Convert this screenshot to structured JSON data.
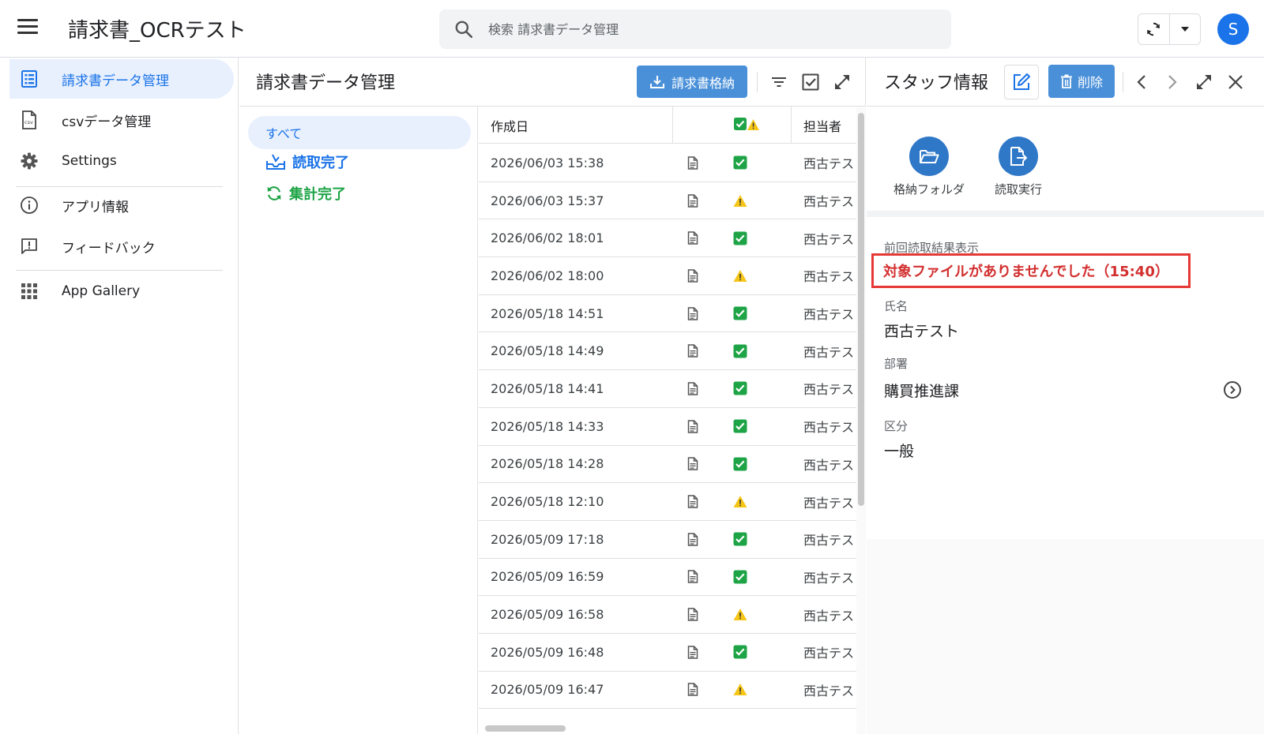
{
  "app": {
    "title": "請求書_OCRテスト",
    "avatar_letter": "S"
  },
  "search": {
    "placeholder": "検索 請求書データ管理"
  },
  "nav": {
    "items": [
      {
        "label": "請求書データ管理"
      },
      {
        "label": "csvデータ管理"
      },
      {
        "label": "Settings"
      },
      {
        "label": "アプリ情報"
      },
      {
        "label": "フィードバック"
      },
      {
        "label": "App Gallery"
      }
    ]
  },
  "middle": {
    "title": "請求書データ管理",
    "primary_button": "請求書格納",
    "filters": {
      "all": "すべて",
      "read_done": "読取完了",
      "aggregate_done": "集計完了"
    },
    "table": {
      "col_date": "作成日",
      "col_owner": "担当者",
      "rows": [
        {
          "date": "2026/06/03 15:38",
          "status": "ok",
          "owner": "西古テスト"
        },
        {
          "date": "2026/06/03 15:37",
          "status": "warn",
          "owner": "西古テスト"
        },
        {
          "date": "2026/06/02 18:01",
          "status": "ok",
          "owner": "西古テスト"
        },
        {
          "date": "2026/06/02 18:00",
          "status": "warn",
          "owner": "西古テスト"
        },
        {
          "date": "2026/05/18 14:51",
          "status": "ok",
          "owner": "西古テスト"
        },
        {
          "date": "2026/05/18 14:49",
          "status": "ok",
          "owner": "西古テスト"
        },
        {
          "date": "2026/05/18 14:41",
          "status": "ok",
          "owner": "西古テスト"
        },
        {
          "date": "2026/05/18 14:33",
          "status": "ok",
          "owner": "西古テスト"
        },
        {
          "date": "2026/05/18 14:28",
          "status": "ok",
          "owner": "西古テスト"
        },
        {
          "date": "2026/05/18 12:10",
          "status": "warn",
          "owner": "西古テスト"
        },
        {
          "date": "2026/05/09 17:18",
          "status": "ok",
          "owner": "西古テスト"
        },
        {
          "date": "2026/05/09 16:59",
          "status": "ok",
          "owner": "西古テスト"
        },
        {
          "date": "2026/05/09 16:58",
          "status": "warn",
          "owner": "西古テスト"
        },
        {
          "date": "2026/05/09 16:48",
          "status": "ok",
          "owner": "西古テスト"
        },
        {
          "date": "2026/05/09 16:47",
          "status": "warn",
          "owner": "西古テスト"
        }
      ]
    }
  },
  "right": {
    "title": "スタッフ情報",
    "delete_label": "削除",
    "actions": {
      "folder": "格納フォルダ",
      "run": "読取実行"
    },
    "fields": {
      "last_result_label": "前回読取結果表示",
      "last_result_value": "対象ファイルがありませんでした（15:40）",
      "name_label": "氏名",
      "name_value": "西古テスト",
      "dept_label": "部署",
      "dept_value": "購買推進課",
      "category_label": "区分",
      "category_value": "一般"
    }
  },
  "colors": {
    "accent": "#1a73e8",
    "button": "#4a90d9",
    "ok": "#1ea446",
    "warn": "#f5c518",
    "alert": "#e53935"
  }
}
